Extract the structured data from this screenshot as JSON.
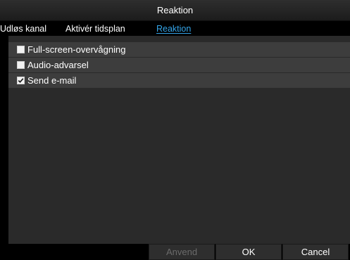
{
  "dialog": {
    "title": "Reaktion"
  },
  "tabs": [
    {
      "label": "Udløs kanal",
      "active": false
    },
    {
      "label": "Aktivér tidsplan",
      "active": false
    },
    {
      "label": "Reaktion",
      "active": true
    }
  ],
  "options": [
    {
      "label": "Full-screen-overvågning",
      "checked": false
    },
    {
      "label": "Audio-advarsel",
      "checked": false
    },
    {
      "label": "Send e-mail",
      "checked": true
    }
  ],
  "buttons": {
    "apply_label": "Anvend",
    "apply_enabled": false,
    "ok_label": "OK",
    "cancel_label": "Cancel"
  },
  "colors": {
    "accent": "#35a6ea",
    "background": "#000000",
    "panel": "#2a2a2a",
    "row": "#3d3d3d",
    "disabled_text": "#6b6b6b"
  }
}
